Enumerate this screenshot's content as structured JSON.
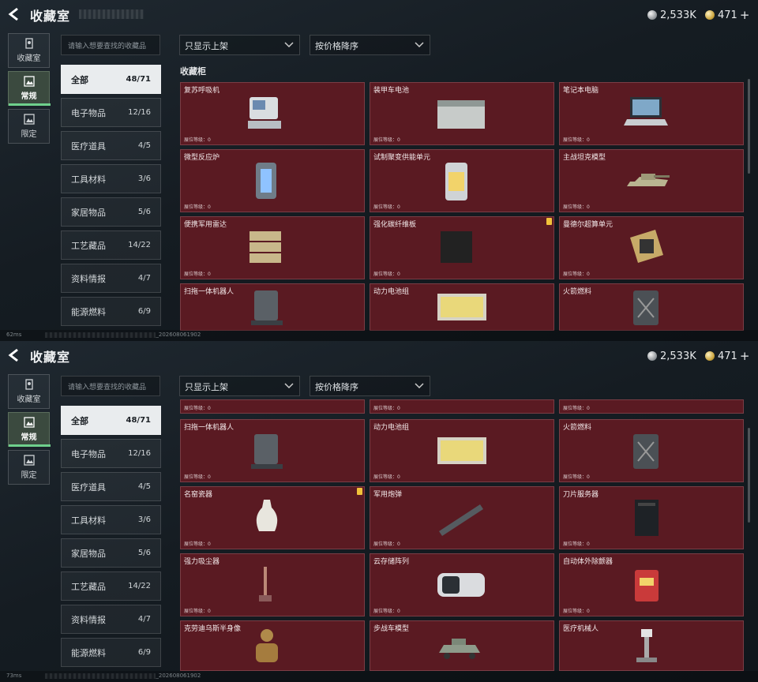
{
  "header": {
    "title": "收藏室",
    "silver": "2,533K",
    "gold": "471",
    "gold_plus": "+"
  },
  "sidetabs": [
    {
      "label": "收藏室",
      "icon": "collection-icon"
    },
    {
      "label": "常规",
      "icon": "regular-icon"
    },
    {
      "label": "限定",
      "icon": "limited-icon"
    }
  ],
  "search": {
    "placeholder": "请输入想要查找的收藏品"
  },
  "filters": {
    "shelf_filter": "只显示上架",
    "sort": "按价格降序"
  },
  "categories": [
    {
      "label": "全部",
      "count": "48/71"
    },
    {
      "label": "电子物品",
      "count": "12/16"
    },
    {
      "label": "医疗道具",
      "count": "4/5"
    },
    {
      "label": "工具材料",
      "count": "3/6"
    },
    {
      "label": "家居物品",
      "count": "5/6"
    },
    {
      "label": "工艺藏品",
      "count": "14/22"
    },
    {
      "label": "资料情报",
      "count": "4/7"
    },
    {
      "label": "能源燃料",
      "count": "6/9"
    }
  ],
  "shelf_title": "收藏柜",
  "level_label": "展位等级：0",
  "items_top": [
    {
      "name": "复苏呼吸机"
    },
    {
      "name": "装甲车电池"
    },
    {
      "name": "笔记本电脑"
    },
    {
      "name": "微型反应炉"
    },
    {
      "name": "试制聚变供能单元"
    },
    {
      "name": "主战坦克模型"
    },
    {
      "name": "便携军用雷达"
    },
    {
      "name": "强化碳纤维板"
    },
    {
      "name": "曼德尔超算单元"
    },
    {
      "name": "扫拖一体机器人"
    },
    {
      "name": "动力电池组"
    },
    {
      "name": "火箭燃料"
    }
  ],
  "items_bottom": [
    {
      "name": "扫拖一体机器人"
    },
    {
      "name": "动力电池组"
    },
    {
      "name": "火箭燃料"
    },
    {
      "name": "名窑瓷器"
    },
    {
      "name": "军用炮弹"
    },
    {
      "name": "刀片服务器"
    },
    {
      "name": "强力吸尘器"
    },
    {
      "name": "云存储阵列"
    },
    {
      "name": "自动体外除颤器"
    },
    {
      "name": "克劳迪乌斯半身像"
    },
    {
      "name": "步战车模型"
    },
    {
      "name": "医疗机械人"
    }
  ],
  "status": {
    "ping_top": "62ms",
    "ping_bottom": "73ms",
    "build": "_202608061902"
  },
  "colors": {
    "card_bg": "#5a1a22",
    "accent_green": "#6fd08c",
    "warn": "#f2c23a"
  }
}
